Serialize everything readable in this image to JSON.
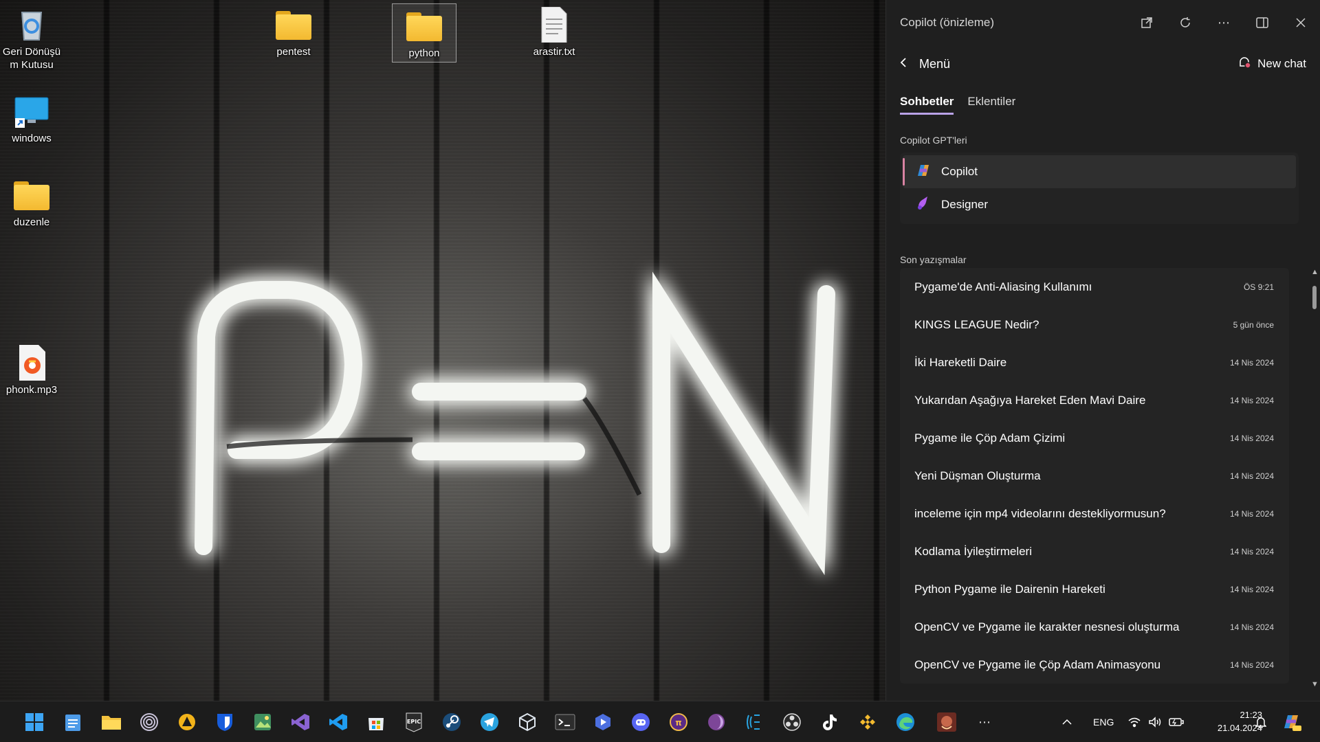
{
  "desktop": {
    "wallpaper_text": "P=N",
    "icons": [
      {
        "label": "Geri Dönüşü\nm Kutusu",
        "icon": "recycle-bin-icon"
      },
      {
        "label": "windows",
        "icon": "monitor-shortcut-icon"
      },
      {
        "label": "duzenle",
        "icon": "folder-icon"
      },
      {
        "label": "phonk.mp3",
        "icon": "audio-file-icon"
      },
      {
        "label": "pentest",
        "icon": "folder-icon"
      },
      {
        "label": "python",
        "icon": "folder-icon"
      },
      {
        "label": "arastir.txt",
        "icon": "text-file-icon"
      }
    ]
  },
  "copilot": {
    "title": "Copilot (önizleme)",
    "menu_label": "Menü",
    "new_chat_label": "New chat",
    "tabs": [
      {
        "label": "Sohbetler",
        "active": true
      },
      {
        "label": "Eklentiler",
        "active": false
      }
    ],
    "gpts_title": "Copilot GPT'leri",
    "gpts": [
      {
        "label": "Copilot",
        "active": true
      },
      {
        "label": "Designer",
        "active": false
      }
    ],
    "recent_title": "Son yazışmalar",
    "chats": [
      {
        "title": "Pygame'de Anti-Aliasing Kullanımı",
        "date": "ÖS 9:21"
      },
      {
        "title": "KINGS LEAGUE Nedir?",
        "date": "5 gün önce"
      },
      {
        "title": "İki Hareketli Daire",
        "date": "14 Nis 2024"
      },
      {
        "title": "Yukarıdan Aşağıya Hareket Eden Mavi Daire",
        "date": "14 Nis 2024"
      },
      {
        "title": "Pygame ile Çöp Adam Çizimi",
        "date": "14 Nis 2024"
      },
      {
        "title": "Yeni Düşman Oluşturma",
        "date": "14 Nis 2024"
      },
      {
        "title": "inceleme için mp4 videolarını destekliyormusun?",
        "date": "14 Nis 2024"
      },
      {
        "title": "Kodlama İyileştirmeleri",
        "date": "14 Nis 2024"
      },
      {
        "title": "Python Pygame ile Dairenin Hareketi",
        "date": "14 Nis 2024"
      },
      {
        "title": "OpenCV ve Pygame ile karakter nesnesi oluşturma",
        "date": "14 Nis 2024"
      },
      {
        "title": "OpenCV ve Pygame ile Çöp Adam Animasyonu",
        "date": "14 Nis 2024"
      }
    ]
  },
  "taskbar": {
    "apps": [
      "windows-start-icon",
      "notepad-icon",
      "file-explorer-icon",
      "tor-browser-icon",
      "artix-icon",
      "bitwarden-icon",
      "image-viewer-icon",
      "visual-studio-icon",
      "vscode-icon",
      "microsoft-store-icon",
      "epic-games-icon",
      "steam-icon",
      "telegram-icon",
      "virtualbox-icon",
      "terminal-icon",
      "app-launcher-icon",
      "discord-icon",
      "tracker-icon",
      "tor-icon",
      "marine-icon",
      "obs-icon",
      "tiktok-icon",
      "binance-icon",
      "edge-icon",
      "game-icon",
      "more-icon"
    ],
    "epic_label": "EPIC",
    "language": "ENG",
    "time": "21:23",
    "date": "21.04.2024"
  }
}
